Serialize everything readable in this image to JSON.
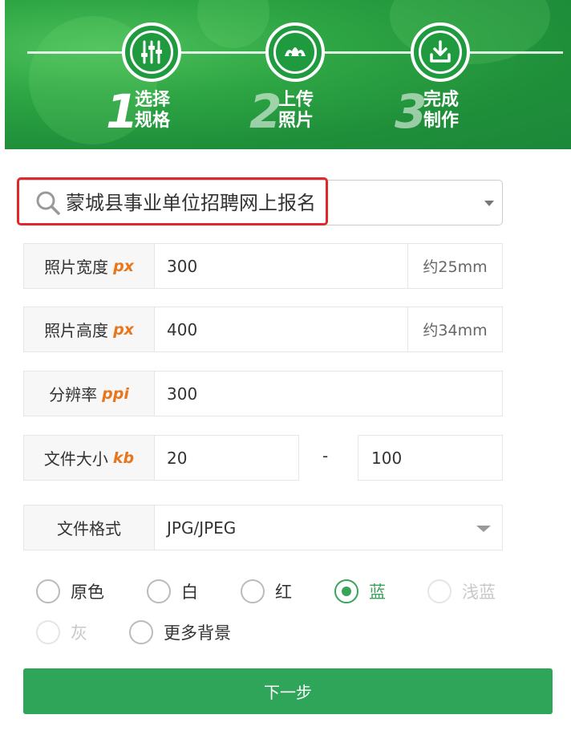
{
  "steps": [
    {
      "num": "1",
      "label_line1": "选择",
      "label_line2": "规格"
    },
    {
      "num": "2",
      "label_line1": "上传",
      "label_line2": "照片"
    },
    {
      "num": "3",
      "label_line1": "完成",
      "label_line2": "制作"
    }
  ],
  "search": {
    "value": "蒙城县事业单位招聘网上报名"
  },
  "fields": {
    "width": {
      "label": "照片宽度",
      "unit": "px",
      "value": "300",
      "suffix": "约25mm"
    },
    "height": {
      "label": "照片高度",
      "unit": "px",
      "value": "400",
      "suffix": "约34mm"
    },
    "resolution": {
      "label": "分辨率",
      "unit": "ppi",
      "value": "300"
    },
    "filesize": {
      "label": "文件大小",
      "unit": "kb",
      "min": "20",
      "separator": "-",
      "max": "100"
    },
    "format": {
      "label": "文件格式",
      "value": "JPG/JPEG"
    }
  },
  "backgrounds": {
    "options": [
      {
        "label": "原色",
        "state": "unchecked"
      },
      {
        "label": "白",
        "state": "unchecked"
      },
      {
        "label": "红",
        "state": "unchecked"
      },
      {
        "label": "蓝",
        "state": "checked"
      },
      {
        "label": "浅蓝",
        "state": "disabled"
      },
      {
        "label": "灰",
        "state": "disabled"
      },
      {
        "label": "更多背景",
        "state": "unchecked"
      }
    ]
  },
  "actions": {
    "next_label": "下一步"
  },
  "colors": {
    "brand_green": "#2fa55a",
    "highlight_red": "#e0282c",
    "unit_orange": "#e8761c"
  }
}
